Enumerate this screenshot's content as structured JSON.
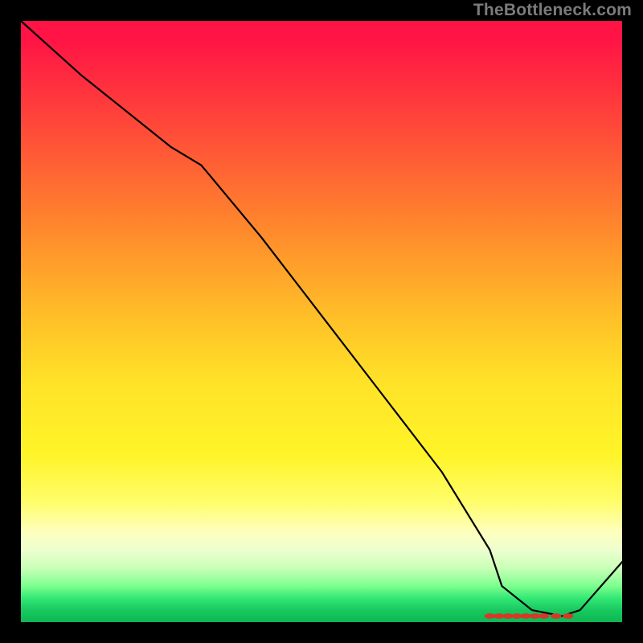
{
  "watermark": "TheBottleneck.com",
  "chart_data": {
    "type": "line",
    "title": "",
    "xlabel": "",
    "ylabel": "",
    "xlim": [
      0,
      100
    ],
    "ylim": [
      0,
      100
    ],
    "series": [
      {
        "name": "bottleneck-curve",
        "x": [
          0,
          10,
          25,
          30,
          40,
          50,
          60,
          70,
          78,
          80,
          85,
          90,
          93,
          100
        ],
        "y": [
          100,
          91,
          79,
          76,
          64,
          51,
          38,
          25,
          12,
          6,
          2,
          1,
          2,
          10
        ]
      }
    ],
    "markers": {
      "name": "optimal-range",
      "y": 1,
      "x_points": [
        78,
        79.5,
        81,
        82.5,
        84,
        85.5,
        87,
        89,
        91
      ]
    },
    "gradient_stops": [
      {
        "pos": 0,
        "color": "#ff1445"
      },
      {
        "pos": 50,
        "color": "#ffe228"
      },
      {
        "pos": 85,
        "color": "#feffbe"
      },
      {
        "pos": 100,
        "color": "#0fb653"
      }
    ]
  }
}
